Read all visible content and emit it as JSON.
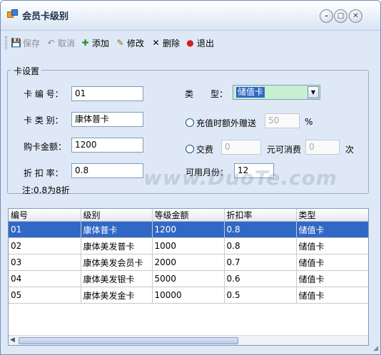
{
  "window": {
    "title": "会员卡级别",
    "min": "–",
    "max": "□",
    "close": "✕"
  },
  "toolbar": {
    "save": {
      "label": "保存",
      "icon": "💾"
    },
    "cancel": {
      "label": "取消",
      "icon": "↶"
    },
    "add": {
      "label": "添加",
      "icon": "✚"
    },
    "edit": {
      "label": "修改",
      "icon": "✎"
    },
    "delete": {
      "label": "删除",
      "icon": "✕"
    },
    "exit": {
      "label": "退出",
      "icon": "●"
    }
  },
  "form": {
    "group_title": "卡设置",
    "card_no_label": "卡 编 号：",
    "card_no": "01",
    "card_class_label": "卡 类 别：",
    "card_class": "康体普卡",
    "amount_label": "购卡金额：",
    "amount": "1200",
    "discount_label": "折 扣 率：",
    "discount": "0.8",
    "note": "注:0.8为8折",
    "type_label": "类　　型：",
    "type_value": "储值卡",
    "bonus_label": "充值时额外赠送",
    "bonus_value": "50",
    "bonus_unit": "%",
    "fee_label": "交费",
    "fee_value": "0",
    "fee_middle": "元可消费",
    "fee_times": "0",
    "fee_unit": "次",
    "months_label": "可用月份：",
    "months": "12"
  },
  "grid": {
    "columns": [
      "编号",
      "级别",
      "等级金额",
      "折扣率",
      "类型"
    ],
    "rows": [
      [
        "01",
        "康体普卡",
        "1200",
        "0.8",
        "储值卡"
      ],
      [
        "02",
        "康体美发普卡",
        "1000",
        "0.8",
        "储值卡"
      ],
      [
        "03",
        "康体美发会员卡",
        "2000",
        "0.7",
        "储值卡"
      ],
      [
        "04",
        "康体美发银卡",
        "5000",
        "0.6",
        "储值卡"
      ],
      [
        "05",
        "康体美发金卡",
        "10000",
        "0.5",
        "储值卡"
      ]
    ]
  },
  "watermark": "www.DuoTe.com"
}
